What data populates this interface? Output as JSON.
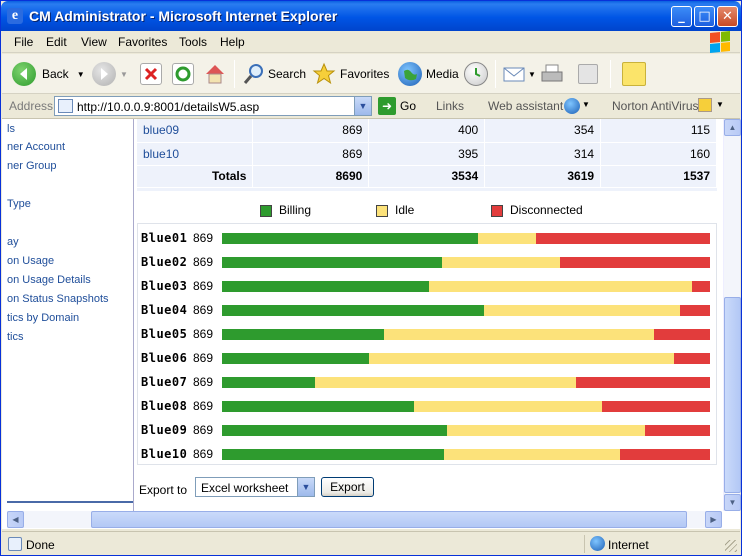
{
  "window": {
    "title": "CM Administrator - Microsoft Internet Explorer"
  },
  "menu": [
    "File",
    "Edit",
    "View",
    "Favorites",
    "Tools",
    "Help"
  ],
  "toolbar": {
    "back": "Back",
    "search": "Search",
    "favorites": "Favorites",
    "media": "Media"
  },
  "addressbar": {
    "label": "Address",
    "url": "http://10.0.0.9:8001/detailsW5.asp",
    "go": "Go",
    "links": "Links",
    "web_assistant": "Web assistant",
    "norton": "Norton AntiVirus"
  },
  "sidebar": {
    "items": [
      "ls",
      "ner Account",
      "ner Group",
      "Type",
      "ay",
      "on Usage",
      "on Usage Details",
      "on Status Snapshots",
      "tics by Domain",
      "tics"
    ]
  },
  "table": {
    "rows": [
      {
        "name": "blue09",
        "total": "869",
        "billing": "400",
        "idle": "354",
        "disconnected": "115"
      },
      {
        "name": "blue10",
        "total": "869",
        "billing": "395",
        "idle": "314",
        "disconnected": "160"
      }
    ],
    "totals": {
      "label": "Totals",
      "total": "8690",
      "billing": "3534",
      "idle": "3619",
      "disconnected": "1537"
    }
  },
  "legend": {
    "billing": {
      "label": "Billing",
      "color": "#2E9B2E"
    },
    "idle": {
      "label": "Idle",
      "color": "#FCE27A"
    },
    "disconnected": {
      "label": "Disconnected",
      "color": "#E23C3C"
    }
  },
  "chart_data": {
    "type": "bar",
    "stacked": true,
    "orientation": "horizontal",
    "categories": [
      "Blue01",
      "Blue02",
      "Blue03",
      "Blue04",
      "Blue05",
      "Blue06",
      "Blue07",
      "Blue08",
      "Blue09",
      "Blue10"
    ],
    "totals": [
      869,
      869,
      869,
      869,
      869,
      869,
      869,
      869,
      869,
      869
    ],
    "series": [
      {
        "name": "Billing",
        "color": "#2E9B2E",
        "values": [
          455,
          392,
          368,
          466,
          288,
          262,
          165,
          342,
          400,
          395
        ]
      },
      {
        "name": "Idle",
        "color": "#FCE27A",
        "values": [
          104,
          210,
          469,
          350,
          482,
          543,
          466,
          335,
          354,
          314
        ]
      },
      {
        "name": "Disconnected",
        "color": "#E23C3C",
        "values": [
          310,
          267,
          32,
          53,
          99,
          64,
          238,
          192,
          115,
          160
        ]
      }
    ]
  },
  "export": {
    "label": "Export to",
    "selected": "Excel worksheet",
    "button": "Export"
  },
  "status": {
    "left": "Done",
    "right": "Internet"
  }
}
